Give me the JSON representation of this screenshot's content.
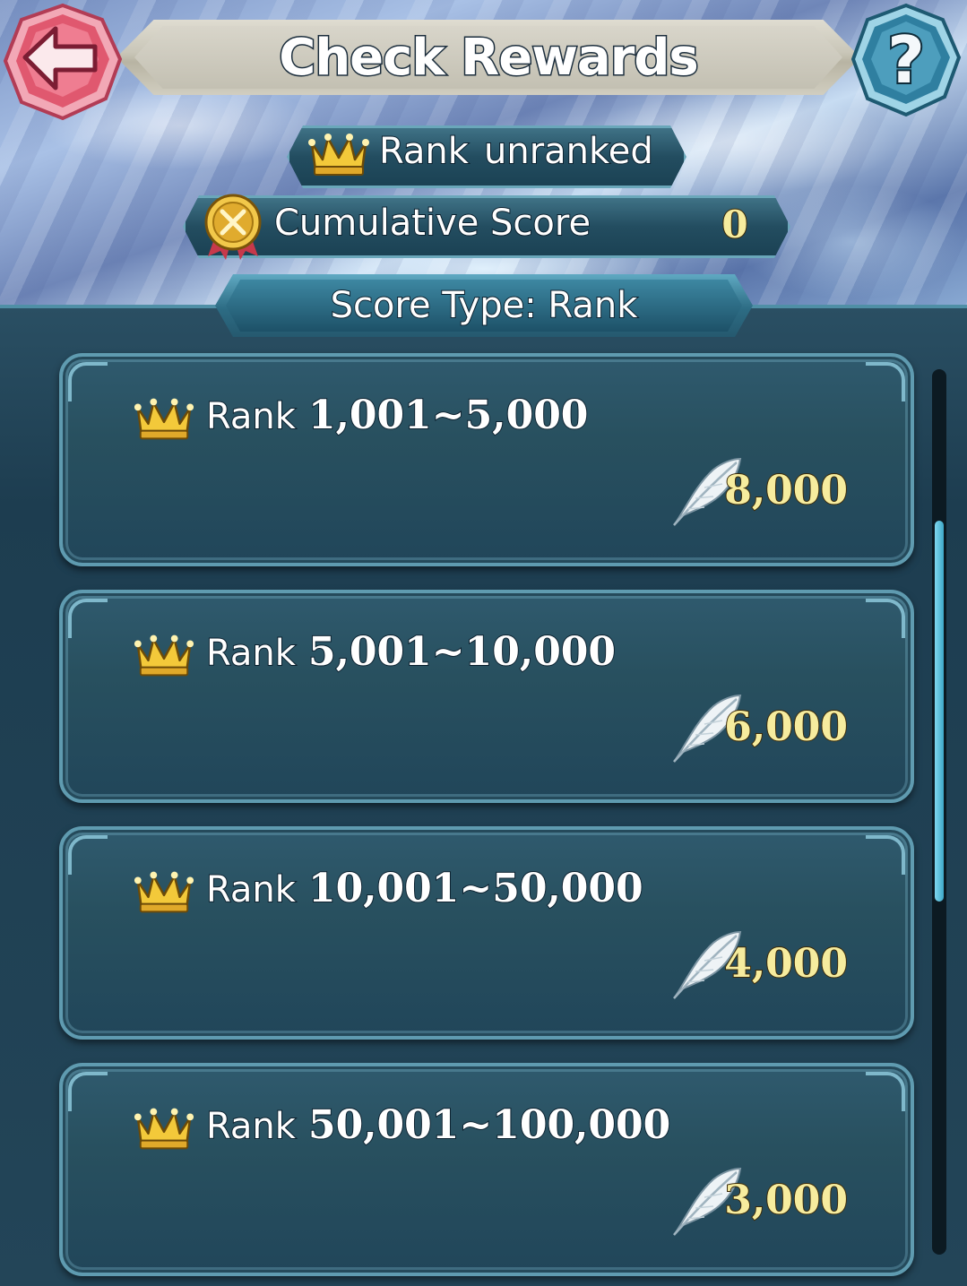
{
  "header": {
    "title": "Check Rewards",
    "back_icon": "back-arrow-icon",
    "help_icon": "help-icon",
    "help_glyph": "?"
  },
  "status": {
    "rank_label": "Rank",
    "rank_value": "unranked",
    "score_label": "Cumulative Score",
    "score_value": "0"
  },
  "score_type": {
    "label": "Score Type: Rank"
  },
  "rewards": [
    {
      "rank_label": "Rank",
      "range": "1,001~5,000",
      "amount": "8,000",
      "icon": "feather-icon"
    },
    {
      "rank_label": "Rank",
      "range": "5,001~10,000",
      "amount": "6,000",
      "icon": "feather-icon"
    },
    {
      "rank_label": "Rank",
      "range": "10,001~50,000",
      "amount": "4,000",
      "icon": "feather-icon"
    },
    {
      "rank_label": "Rank",
      "range": "50,001~100,000",
      "amount": "3,000",
      "icon": "feather-icon"
    }
  ],
  "colors": {
    "accent": "#5f9bb0",
    "reward_text": "#f6ec9e",
    "back_button": "#e0586f",
    "help_button": "#2f7fa0"
  },
  "scroll": {
    "position_fraction": 0.14,
    "visible_fraction": 0.43
  }
}
